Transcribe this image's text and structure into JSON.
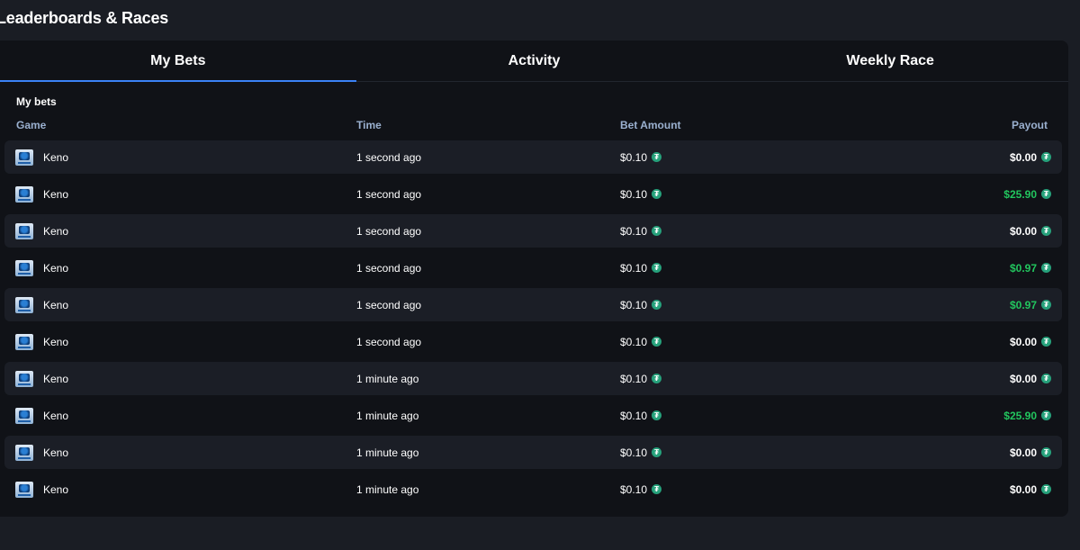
{
  "page": {
    "title": "Leaderboards & Races"
  },
  "tabs": [
    {
      "label": "My Bets",
      "active": true
    },
    {
      "label": "Activity",
      "active": false
    },
    {
      "label": "Weekly Race",
      "active": false
    }
  ],
  "section": {
    "title": "My bets"
  },
  "columns": {
    "game": "Game",
    "time": "Time",
    "bet_amount": "Bet Amount",
    "payout": "Payout"
  },
  "colors": {
    "accent": "#3b82f6",
    "win": "#22c55e",
    "coin": "#26a17b"
  },
  "coin": {
    "icon": "tether-coin-icon",
    "glyph": "₮"
  },
  "bets": [
    {
      "game": "Keno",
      "time": "1 second ago",
      "amount": "$0.10",
      "payout": "$0.00",
      "win": false
    },
    {
      "game": "Keno",
      "time": "1 second ago",
      "amount": "$0.10",
      "payout": "$25.90",
      "win": true
    },
    {
      "game": "Keno",
      "time": "1 second ago",
      "amount": "$0.10",
      "payout": "$0.00",
      "win": false
    },
    {
      "game": "Keno",
      "time": "1 second ago",
      "amount": "$0.10",
      "payout": "$0.97",
      "win": true
    },
    {
      "game": "Keno",
      "time": "1 second ago",
      "amount": "$0.10",
      "payout": "$0.97",
      "win": true
    },
    {
      "game": "Keno",
      "time": "1 second ago",
      "amount": "$0.10",
      "payout": "$0.00",
      "win": false
    },
    {
      "game": "Keno",
      "time": "1 minute ago",
      "amount": "$0.10",
      "payout": "$0.00",
      "win": false
    },
    {
      "game": "Keno",
      "time": "1 minute ago",
      "amount": "$0.10",
      "payout": "$25.90",
      "win": true
    },
    {
      "game": "Keno",
      "time": "1 minute ago",
      "amount": "$0.10",
      "payout": "$0.00",
      "win": false
    },
    {
      "game": "Keno",
      "time": "1 minute ago",
      "amount": "$0.10",
      "payout": "$0.00",
      "win": false
    }
  ]
}
